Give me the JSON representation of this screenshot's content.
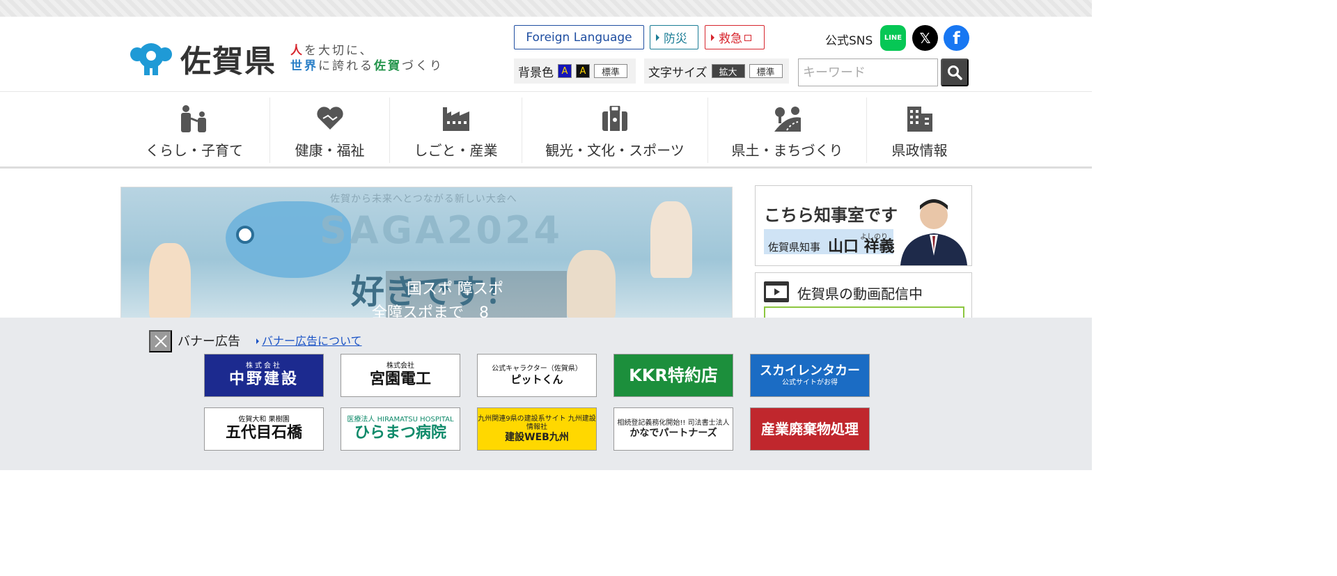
{
  "header": {
    "logo_title": "佐賀県",
    "tagline_line1_a": "人",
    "tagline_line1_b": "を大切に、",
    "tagline_line2_a": "世界",
    "tagline_line2_b": "に誇れる",
    "tagline_line2_c": "佐賀",
    "tagline_line2_d": "づくり",
    "foreign_language": "Foreign Language",
    "bousai": "防災",
    "kyukyu": "救急",
    "sns_label": "公式SNS",
    "sns_line": "LINE",
    "sns_x": "𝕏",
    "sns_facebook": "f",
    "bg_color_label": "背景色",
    "bg_blue": "A",
    "bg_black": "A",
    "bg_standard": "標準",
    "font_size_label": "文字サイズ",
    "font_enlarge": "拡大",
    "font_standard": "標準",
    "search_placeholder": "キーワード"
  },
  "nav": {
    "items": [
      {
        "label": "くらし・子育て",
        "icon": "family-icon"
      },
      {
        "label": "健康・福祉",
        "icon": "heart-handshake-icon"
      },
      {
        "label": "しごと・産業",
        "icon": "factory-icon"
      },
      {
        "label": "観光・文化・スポーツ",
        "icon": "suitcase-icon"
      },
      {
        "label": "県土・まちづくり",
        "icon": "road-tree-icon"
      },
      {
        "label": "県政情報",
        "icon": "building-icon"
      }
    ]
  },
  "hero": {
    "subtitle": "佐賀から未来へとつながる新しい大会へ",
    "big_text": "SAGA2024",
    "suki": "好きです！",
    "panel_line1": "国スポ 障スポ",
    "panel_line2": "全障スポまで　8"
  },
  "sidebar": {
    "governor_title": "こちら知事室です",
    "governor_role": "佐賀県知事",
    "governor_name": "山口 祥義",
    "governor_ruby": "よしのり",
    "video_title": "佐賀県の動画配信中"
  },
  "banner": {
    "heading": "バナー広告",
    "link": "バナー広告について",
    "ads": [
      {
        "main": "中野建設",
        "sub": "株式会社"
      },
      {
        "main": "宮園電工",
        "sub": "株式会社"
      },
      {
        "main": "ピットくん",
        "sub": "公式キャラクター（佐賀県）"
      },
      {
        "main": "KKR特約店",
        "sub": ""
      },
      {
        "main": "スカイレンタカー",
        "sub": "公式サイトがお得"
      },
      {
        "main": "五代目石橋",
        "sub": "佐賀大和 果樹園"
      },
      {
        "main": "ひらまつ病院",
        "sub": "医療法人 HIRAMATSU HOSPITAL"
      },
      {
        "main": "建設WEB九州",
        "sub": "九州関連9県の建設系サイト 九州建設情報社"
      },
      {
        "main": "かなでパートナーズ",
        "sub": "相続登記義務化開始!! 司法書士法人"
      },
      {
        "main": "産業廃棄物処理",
        "sub": ""
      }
    ]
  },
  "colors": {
    "brand_blue": "#1f9ad6",
    "accent_red": "#d7262e",
    "nav_icon": "#555555"
  }
}
